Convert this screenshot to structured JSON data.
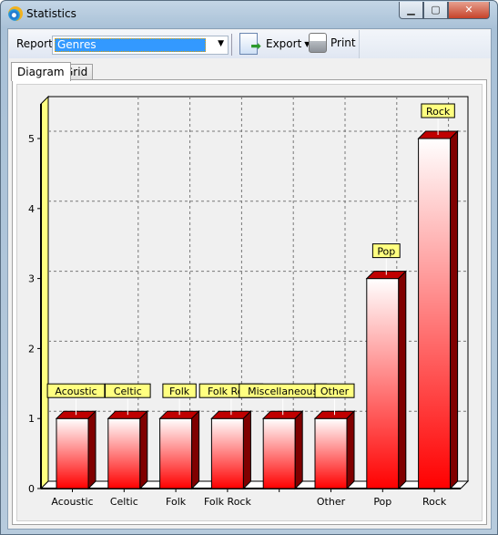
{
  "window": {
    "title": "Statistics",
    "minimize": "▁",
    "maximize": "▢",
    "close": "✕"
  },
  "toolbar": {
    "report_label": "Report",
    "report_value": "Genres",
    "export_label": "Export",
    "print_label": "Print"
  },
  "tabs": [
    {
      "label": "Diagram",
      "active": true
    },
    {
      "label": "Grid",
      "active": false
    }
  ],
  "colors": {
    "bar_top": "#ffffff",
    "bar_bottom": "#ff0000",
    "bar_side": "#800000",
    "label_bg": "#ffff80",
    "wall": "#ffff80"
  },
  "chart_data": {
    "type": "bar",
    "categories": [
      "Acoustic",
      "Celtic",
      "Folk",
      "Folk Rock",
      "Miscellaneous",
      "Other",
      "Pop",
      "Rock"
    ],
    "x_tick_labels": [
      "Acoustic",
      "Celtic",
      "Folk",
      "Folk Rock",
      "",
      "Other",
      "Pop",
      "Rock"
    ],
    "values": [
      1,
      1,
      1,
      1,
      1,
      1,
      3,
      5
    ],
    "data_labels": [
      "Acoustic",
      "Celtic",
      "Folk",
      "Folk Rock",
      "Miscellaneous",
      "Other",
      "Pop",
      "Rock"
    ],
    "y_ticks": [
      "0",
      "1",
      "2",
      "3",
      "4",
      "5"
    ],
    "ylim": [
      0,
      5.5
    ],
    "grid": true,
    "style": "3d"
  }
}
